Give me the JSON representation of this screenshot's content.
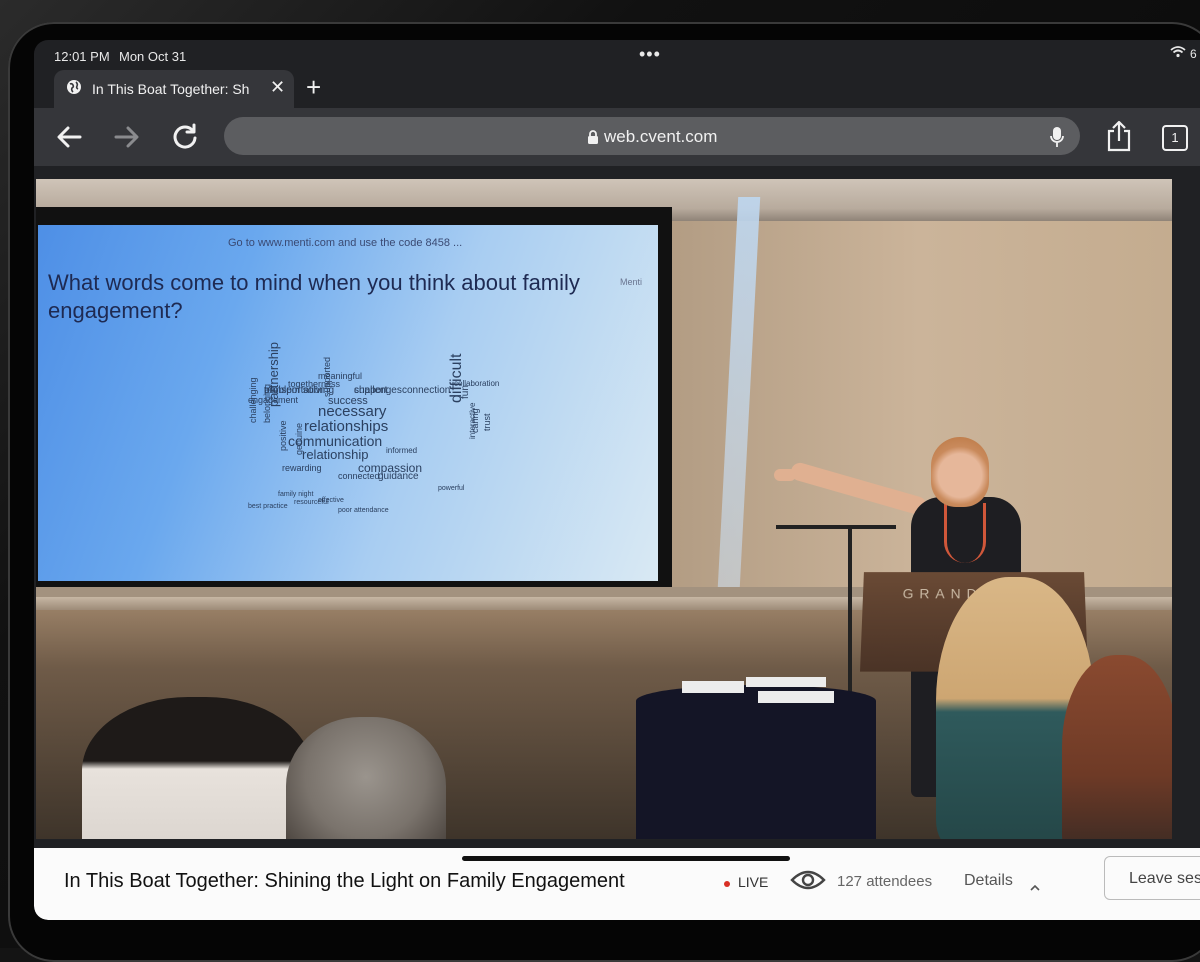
{
  "status_bar": {
    "time": "12:01 PM",
    "date": "Mon Oct 31",
    "multitask": "•••",
    "battery": "6"
  },
  "browser": {
    "tab_title": "In This Boat Together: Sh",
    "url": "web.cvent.com",
    "tab_count": "1",
    "close": "✕",
    "new_tab": "+"
  },
  "slide": {
    "code_line": "Go to www.menti.com and use the code 8458 ...",
    "brand": "Menti",
    "question": "What words come to mind when you think about family engagement?",
    "word_cloud": [
      "transportation",
      "support",
      "connection",
      "collaboration",
      "success",
      "necessary",
      "relationships",
      "communication",
      "relationship",
      "compassion",
      "difficult",
      "partnership",
      "challenging",
      "belonging",
      "rewarding",
      "connected",
      "guidance",
      "meaningful",
      "togetherness",
      "engagement",
      "supported",
      "fun",
      "caring",
      "positive",
      "genuine",
      "trust",
      "interactive",
      "informed",
      "powerful",
      "effective",
      "resourceful",
      "best practice",
      "poor attendance",
      "family night",
      "problem solving",
      "challenges"
    ]
  },
  "venue_sign": "GRAND H",
  "event_bar": {
    "title": "In This Boat Together: Shining the Light on Family Engagement",
    "live_label": "LIVE",
    "attendees": "127 attendees",
    "details_label": "Details",
    "leave_label": "Leave ses"
  },
  "colors": {
    "live_dot": "#d93025",
    "browser_chrome": "#35363a",
    "url_bar": "#5c5d60",
    "event_bar": "#fbfbfb"
  }
}
